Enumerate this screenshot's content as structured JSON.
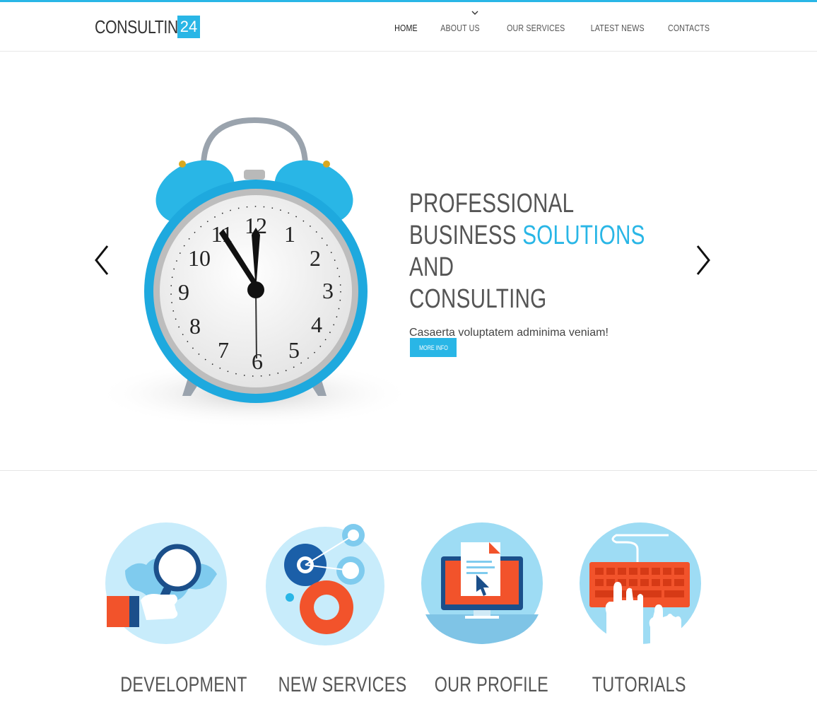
{
  "brand": {
    "name": "CONSULTING",
    "badge": "24",
    "accent_color": "#29b6e6"
  },
  "nav": {
    "items": [
      {
        "label": "HOME",
        "active": true
      },
      {
        "label": "ABOUT US",
        "active": false
      },
      {
        "label": "OUR SERVICES",
        "active": false
      },
      {
        "label": "LATEST NEWS",
        "active": false
      },
      {
        "label": "CONTACTS",
        "active": false
      }
    ]
  },
  "hero": {
    "title_line1": "PROFESSIONAL",
    "title_line2_pre": "BUSINESS ",
    "title_line2_accent": "SOLUTIONS",
    "title_line2_post": " AND",
    "title_line3": "CONSULTING",
    "subtitle": "Casaerta voluptatem adminima veniam!",
    "button_label": "MORE INFO",
    "prev_icon": "chevron-left-icon",
    "next_icon": "chevron-right-icon"
  },
  "features": [
    {
      "title": "DEVELOPMENT",
      "icon": "world-map-magnifier-icon"
    },
    {
      "title": "NEW SERVICES",
      "icon": "gears-icon"
    },
    {
      "title": "OUR PROFILE",
      "icon": "monitor-document-icon"
    },
    {
      "title": "TUTORIALS",
      "icon": "keyboard-hands-icon"
    }
  ]
}
